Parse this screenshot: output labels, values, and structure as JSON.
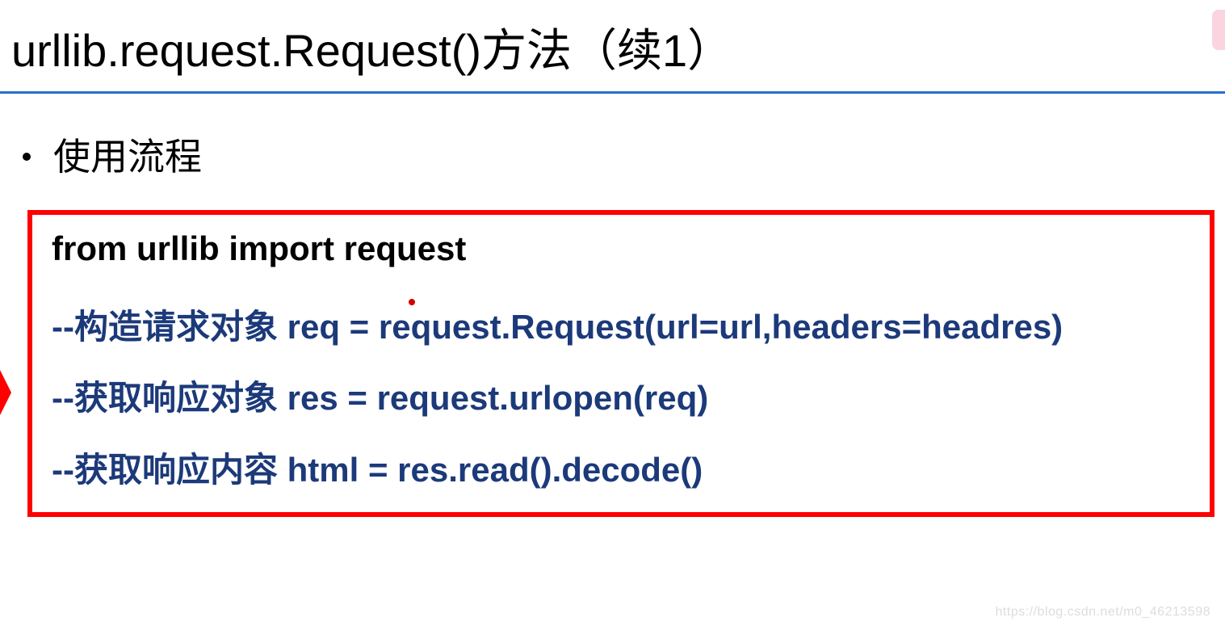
{
  "title": "urllib.request.Request()方法（续1）",
  "bullet": "使用流程",
  "code": {
    "import_line": "from urllib import request",
    "step1": "--构造请求对象  req = request.Request(url=url,headers=headres)",
    "step2": "--获取响应对象  res = request.urlopen(req)",
    "step3": "--获取响应内容  html = res.read().decode()"
  },
  "watermark": "https://blog.csdn.net/m0_46213598"
}
